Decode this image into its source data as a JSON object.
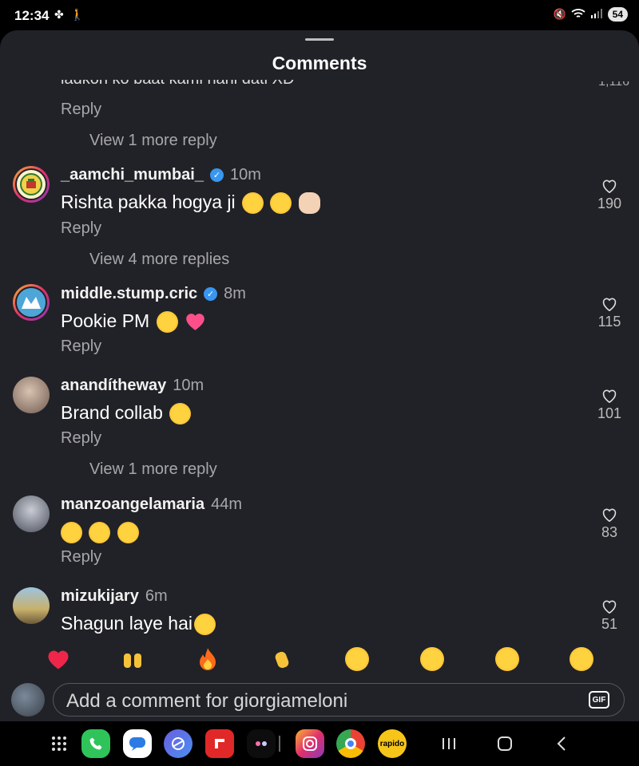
{
  "status_bar": {
    "time": "12:34",
    "battery": "54"
  },
  "sheet": {
    "title": "Comments"
  },
  "partial": {
    "text": "ladkon ko baat kami nahi dati XD",
    "likes": "1,116",
    "reply_label": "Reply"
  },
  "comments": [
    {
      "username": "_aamchi_mumbai_",
      "verified": true,
      "time": "10m",
      "text": "Rishta pakka hogya ji",
      "emojis": [
        "smiling-face-with-hearts",
        "face-with-hand-over-mouth",
        "pinching-hand"
      ],
      "likes": "190",
      "reply_label": "Reply",
      "more_replies": "View 4 more replies"
    },
    {
      "username": "middle.stump.cric",
      "verified": true,
      "time": "8m",
      "text": "Pookie PM",
      "emojis": [
        "tears-of-joy",
        "pink-heart"
      ],
      "likes": "115",
      "reply_label": "Reply",
      "more_replies": ""
    },
    {
      "username": "anandítheway",
      "verified": false,
      "time": "10m",
      "text": "Brand collab",
      "emojis": [
        "tears-of-joy"
      ],
      "likes": "101",
      "reply_label": "Reply",
      "more_replies": "View 1 more reply"
    },
    {
      "username": "manzoangelamaria",
      "verified": false,
      "time": "44m",
      "text": "",
      "emojis": [
        "smiling-face-with-hearts",
        "smiling-face-with-hearts",
        "smiling-face-with-hearts"
      ],
      "likes": "83",
      "reply_label": "Reply",
      "more_replies": ""
    },
    {
      "username": "mizukijary",
      "verified": false,
      "time": "6m",
      "text": "Shagun laye hai",
      "emojis": [
        "squinting-face-with-tongue"
      ],
      "likes": "51",
      "reply_label": "",
      "more_replies": ""
    }
  ],
  "view_more_top": "View 1 more reply",
  "reactions": [
    "red-heart",
    "raising-hands",
    "fire",
    "clapping-hands",
    "crying-face",
    "heart-eyes",
    "face-with-open-mouth",
    "tears-of-joy"
  ],
  "composer": {
    "placeholder": "Add a comment for giorgiameloni",
    "gif_label": "GIF"
  },
  "nav": {
    "apps": [
      "phone",
      "messages",
      "internet",
      "flipboard",
      "camera-app",
      "instagram",
      "chrome",
      "rapido"
    ],
    "rapido_label": "rapido"
  },
  "colors": {
    "sheet_bg": "#212227",
    "accent_blue": "#3897f0",
    "muted": "#a7a7ab"
  }
}
